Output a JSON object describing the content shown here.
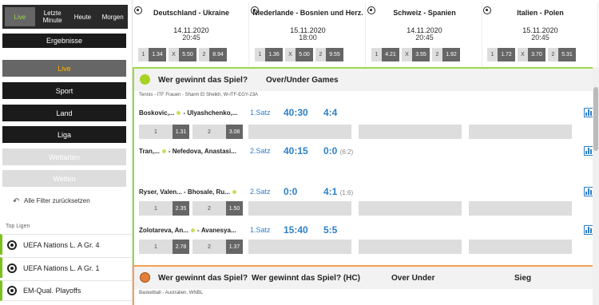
{
  "sidebar": {
    "time_tabs": [
      "Live",
      "Letzte Minute",
      "Heute",
      "Morgen"
    ],
    "ergebnisse": "Ergebnisse",
    "live": "Live",
    "sport": "Sport",
    "land": "Land",
    "liga": "Liga",
    "wettarten": "Wettarten",
    "wetten": "Wetten",
    "reset": "Alle Filter zurücksetzen",
    "top_ligen": "Top Ligen",
    "leagues": [
      "UEFA Nations L. A Gr. 4",
      "UEFA Nations L. A Gr. 1",
      "EM-Qual. Playoffs"
    ]
  },
  "cards": [
    {
      "title": "Deutschland - Ukraine",
      "date": "14.11.2020",
      "time": "20:45",
      "odds": [
        "1.34",
        "5.50",
        "8.94"
      ]
    },
    {
      "title": "Niederlande - Bosnien und Herz.",
      "date": "15.11.2020",
      "time": "18:00",
      "odds": [
        "1.36",
        "5.00",
        "9.55"
      ]
    },
    {
      "title": "Schweiz - Spanien",
      "date": "14.11.2020",
      "time": "20:45",
      "odds": [
        "4.21",
        "3.55",
        "1.92"
      ]
    },
    {
      "title": "Italien - Polen",
      "date": "15.11.2020",
      "time": "20:45",
      "odds": [
        "1.72",
        "3.70",
        "5.31"
      ]
    }
  ],
  "odd_keys": [
    "1",
    "X",
    "2"
  ],
  "tennis": {
    "head1": "Wer gewinnt das Spiel?",
    "head2": "Over/Under Games",
    "league": "Tennis - ITF Frauen - Sharm El Sheikh, W-ITF-EGY-23A",
    "matches": [
      {
        "p1": "Boskovic,...",
        "p2": "Ulyashchenko,...",
        "satz": "1.Satz",
        "s1": "40:30",
        "s2": "4:4",
        "sub": "",
        "o1": "1.31",
        "o2": "3.08"
      },
      {
        "p1": "Tran,...",
        "p2": "Nefedova, Anastasi...",
        "satz": "2.Satz",
        "s1": "40:15",
        "s2": "0:0",
        "sub": "(6:2)",
        "o1": "",
        "o2": ""
      },
      {
        "p1": "Ryser, Valen...",
        "p2": "Bhosale, Ru...",
        "satz": "2.Satz",
        "s1": "0:0",
        "s2": "4:1",
        "sub": "(1:6)",
        "o1": "2.35",
        "o2": "1.50"
      },
      {
        "p1": "Zolotareva, An...",
        "p2": "Avanesya...",
        "satz": "1.Satz",
        "s1": "15:40",
        "s2": "5:5",
        "sub": "",
        "o1": "2.78",
        "o2": "1.37"
      }
    ]
  },
  "basket": {
    "head1": "Wer gewinnt das Spiel?",
    "head2": "Wer gewinnt das Spiel? (HC)",
    "head3": "Over Under",
    "head4": "Sieg",
    "league": "Basketball - Australien, WNBL"
  },
  "colors": {
    "accent_green": "#9bd84a",
    "accent_orange": "#f6a057",
    "score_blue": "#2d7fc7"
  }
}
